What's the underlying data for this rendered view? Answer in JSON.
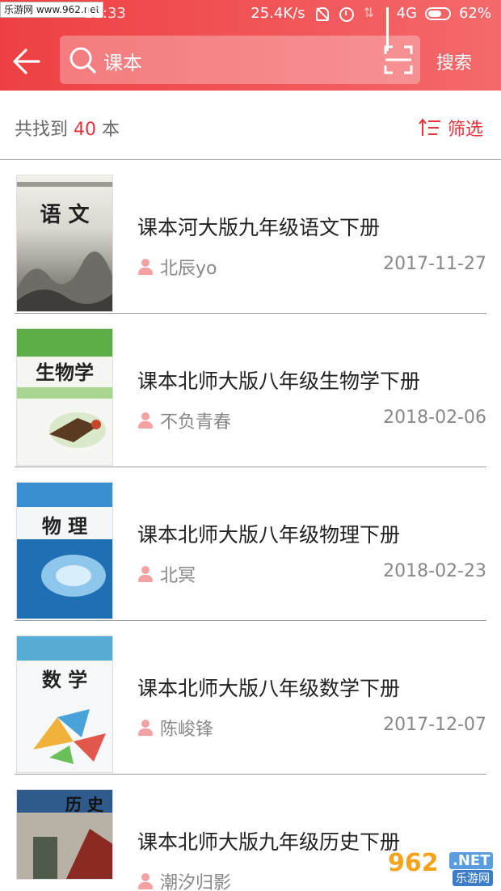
{
  "status_bar": {
    "watermark": "乐游网 www.962.net",
    "time": "12:33",
    "net_speed": "25.4K/s",
    "network": "4G",
    "battery": "62%"
  },
  "search": {
    "query": "课本",
    "button_label": "搜索"
  },
  "results": {
    "prefix": "共找到",
    "count": "40",
    "suffix": "本",
    "filter_label": "筛选"
  },
  "books": [
    {
      "title": "课本河大版九年级语文下册",
      "author": "北辰yo",
      "date": "2017-11-27",
      "cover_title": "语 文",
      "cover_color": "#cfcfcf"
    },
    {
      "title": "课本北师大版八年级生物学下册",
      "author": "不负青春",
      "date": "2018-02-06",
      "cover_title": "生物学",
      "cover_color": "#66b84a"
    },
    {
      "title": "课本北师大版八年级物理下册",
      "author": "北冥",
      "date": "2018-02-23",
      "cover_title": "物 理",
      "cover_color": "#2a86c8"
    },
    {
      "title": "课本北师大版八年级数学下册",
      "author": "陈峻锋",
      "date": "2017-12-07",
      "cover_title": "数 学",
      "cover_color": "#5fb2d8"
    },
    {
      "title": "课本北师大版九年级历史下册",
      "author": "潮汐归影",
      "date": "",
      "cover_title": "历 史",
      "cover_color": "#8a2a22"
    }
  ],
  "site_logo": {
    "number": "962",
    "domain": ".NET",
    "name": "乐游网"
  },
  "colors": {
    "accent": "#e8333a",
    "header_start": "#ee4043",
    "header_end": "#f46a6c",
    "user_icon": "#f4a1a3"
  }
}
